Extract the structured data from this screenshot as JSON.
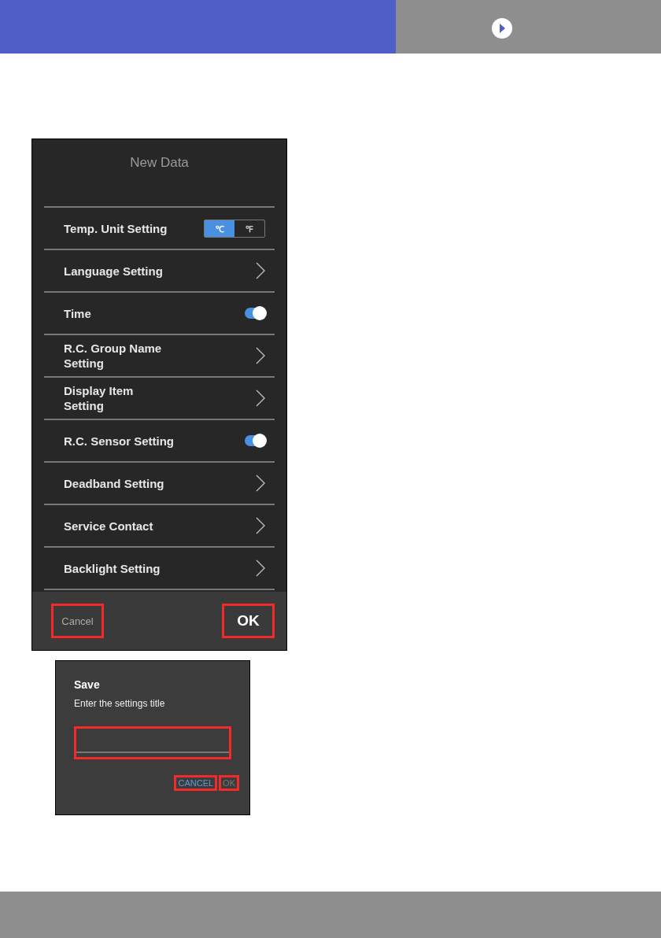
{
  "settings_screen": {
    "title": "New Data",
    "rows": [
      {
        "label": "Temp. Unit Setting",
        "kind": "segmented",
        "options": [
          {
            "label": "℃",
            "selected": true
          },
          {
            "label": "℉",
            "selected": false
          }
        ]
      },
      {
        "label": "Language Setting",
        "kind": "link"
      },
      {
        "label": "Time",
        "kind": "toggle",
        "on": true
      },
      {
        "label": "R.C. Group Name\nSetting",
        "kind": "link"
      },
      {
        "label": "Display Item\nSetting",
        "kind": "link"
      },
      {
        "label": "R.C. Sensor Setting",
        "kind": "toggle",
        "on": true
      },
      {
        "label": "Deadband Setting",
        "kind": "link"
      },
      {
        "label": "Service Contact",
        "kind": "link"
      },
      {
        "label": "Backlight Setting",
        "kind": "link"
      }
    ],
    "cancel": {
      "label": "Cancel",
      "highlighted": true
    },
    "ok": {
      "label": "OK",
      "highlighted": true
    }
  },
  "save_dialog": {
    "title": "Save",
    "message": "Enter the settings title",
    "field": {
      "highlighted": true
    },
    "buttons": [
      {
        "label": "CANCEL",
        "disabled": false,
        "highlighted": true
      },
      {
        "label": "OK",
        "disabled": true,
        "highlighted": true
      }
    ]
  }
}
